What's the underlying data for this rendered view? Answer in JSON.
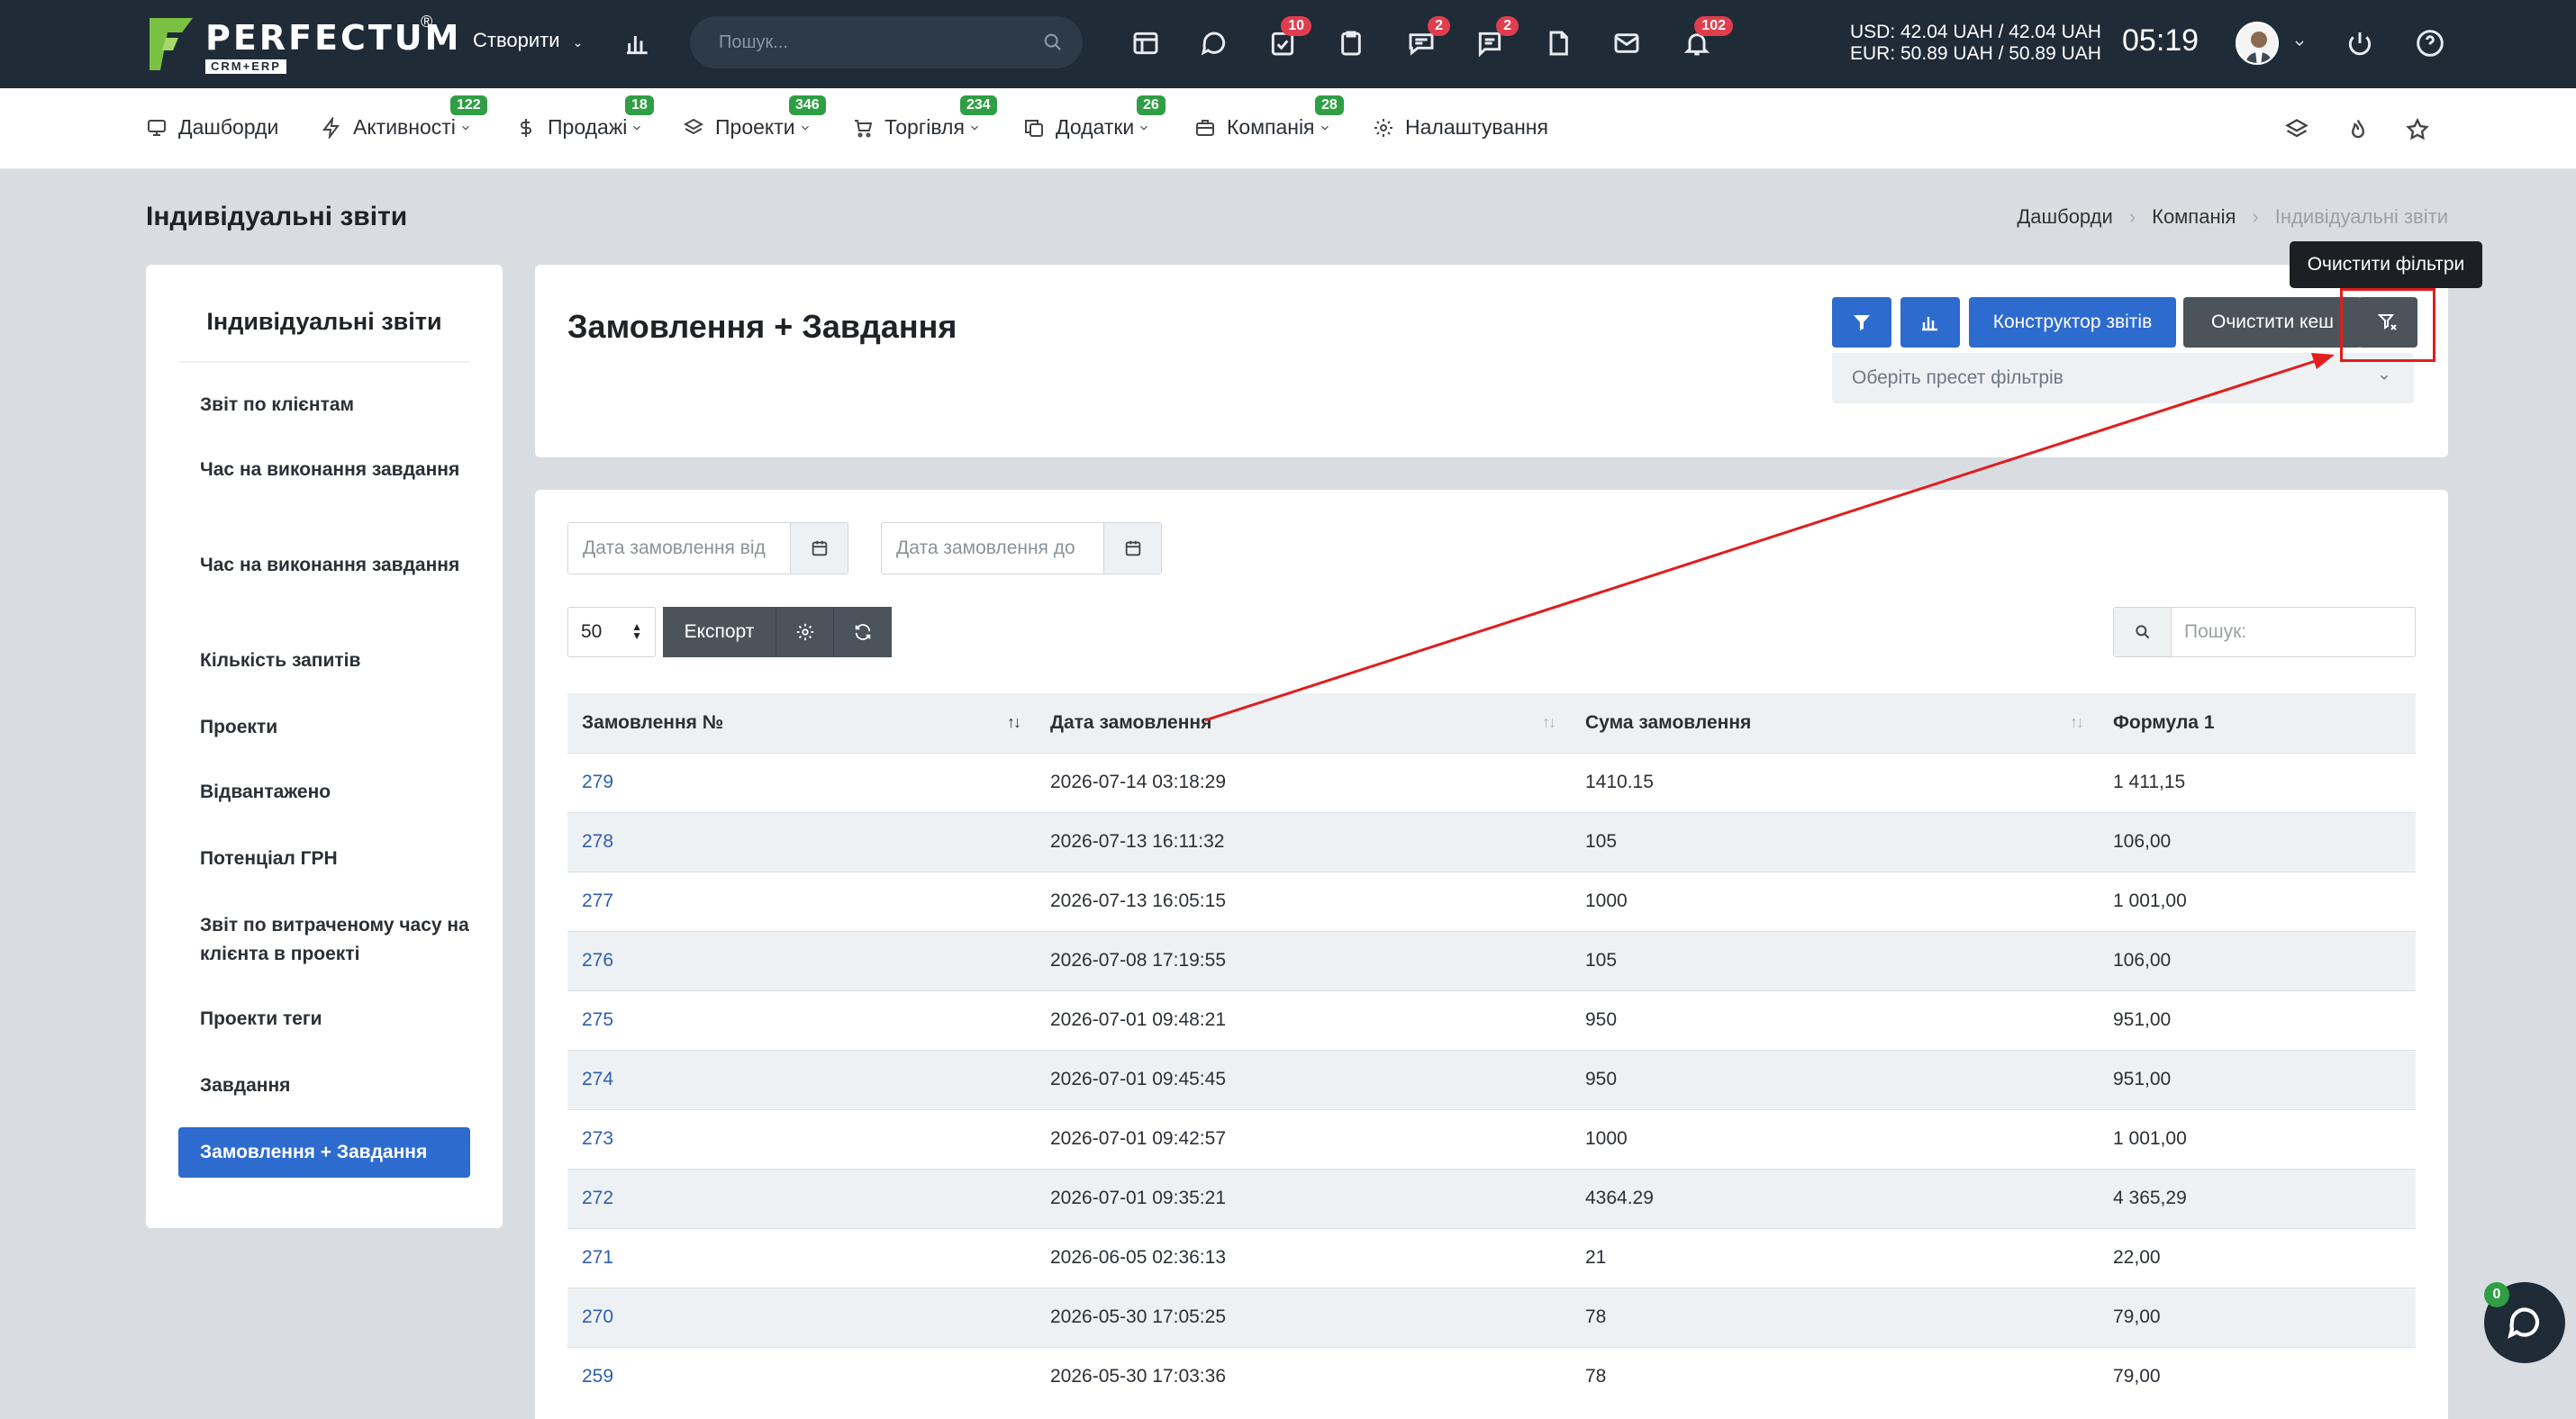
{
  "app": {
    "logo_text": "PERFECTUM",
    "logo_sub": "CRM+ERP",
    "logo_reg": "®",
    "create_label": "Створити",
    "search_placeholder": "Пошук...",
    "badges": {
      "tasks": "10",
      "chat1": "2",
      "chat2": "2",
      "notifications": "102"
    },
    "currency_usd": "USD: 42.04 UAH / 42.04 UAH",
    "currency_eur": "EUR: 50.89 UAH / 50.89 UAH",
    "clock": "05:19"
  },
  "nav": {
    "items": [
      {
        "label": "Дашборди",
        "badge": "",
        "icon": "monitor-icon"
      },
      {
        "label": "Активності",
        "badge": "122",
        "icon": "bolt-icon"
      },
      {
        "label": "Продажі",
        "badge": "18",
        "icon": "dollar-icon"
      },
      {
        "label": "Проекти",
        "badge": "346",
        "icon": "layers-icon"
      },
      {
        "label": "Торгівля",
        "badge": "234",
        "icon": "cart-icon"
      },
      {
        "label": "Додатки",
        "badge": "26",
        "icon": "copy-icon"
      },
      {
        "label": "Компанія",
        "badge": "28",
        "icon": "briefcase-icon"
      },
      {
        "label": "Налаштування",
        "badge": "",
        "icon": "gear-icon"
      }
    ]
  },
  "page": {
    "title": "Індивідуальні звіти",
    "breadcrumb": [
      "Дашборди",
      "Компанія",
      "Індивідуальні звіти"
    ]
  },
  "sidebar": {
    "title": "Індивідуальні звіти",
    "items": [
      {
        "label": "Звіт по клієнтам"
      },
      {
        "label": "Час на виконання завдання"
      },
      {
        "label": "Час на виконання завдання"
      },
      {
        "label": "Кількість запитів"
      },
      {
        "label": "Проекти"
      },
      {
        "label": "Відвантажено"
      },
      {
        "label": "Потенціал ГРН"
      },
      {
        "label": "Звіт по витраченому часу на клієнта в проекті"
      },
      {
        "label": "Проекти теги"
      },
      {
        "label": "Завдання"
      },
      {
        "label": "Замовлення + Завдання"
      }
    ]
  },
  "report": {
    "title": "Замовлення + Завдання",
    "constructor_label": "Конструктор звітів",
    "clear_cache_label": "Очистити кеш",
    "preset_placeholder": "Оберіть пресет фільтрів",
    "tooltip": "Очистити фільтри",
    "date_from_placeholder": "Дата замовлення від",
    "date_to_placeholder": "Дата замовлення до",
    "per_page": "50",
    "export_label": "Експорт",
    "search_placeholder": "Пошук:"
  },
  "table": {
    "columns": [
      "Замовлення №",
      "Дата замовлення",
      "Сума замовлення",
      "Формула 1"
    ],
    "rows": [
      [
        "279",
        "2026-07-14 03:18:29",
        "1410.15",
        "1 411,15"
      ],
      [
        "278",
        "2026-07-13 16:11:32",
        "105",
        "106,00"
      ],
      [
        "277",
        "2026-07-13 16:05:15",
        "1000",
        "1 001,00"
      ],
      [
        "276",
        "2026-07-08 17:19:55",
        "105",
        "106,00"
      ],
      [
        "275",
        "2026-07-01 09:48:21",
        "950",
        "951,00"
      ],
      [
        "274",
        "2026-07-01 09:45:45",
        "950",
        "951,00"
      ],
      [
        "273",
        "2026-07-01 09:42:57",
        "1000",
        "1 001,00"
      ],
      [
        "272",
        "2026-07-01 09:35:21",
        "4364.29",
        "4 365,29"
      ],
      [
        "271",
        "2026-06-05 02:36:13",
        "21",
        "22,00"
      ],
      [
        "270",
        "2026-05-30 17:05:25",
        "78",
        "79,00"
      ],
      [
        "259",
        "2026-05-30 17:03:36",
        "78",
        "79,00"
      ]
    ]
  },
  "chat": {
    "badge": "0"
  },
  "colors": {
    "accent": "#2d6bcf",
    "topbar": "#1f2b37",
    "badge_red": "#e03e4e",
    "badge_green": "#2f9e44",
    "annotation": "#e21d1d"
  }
}
